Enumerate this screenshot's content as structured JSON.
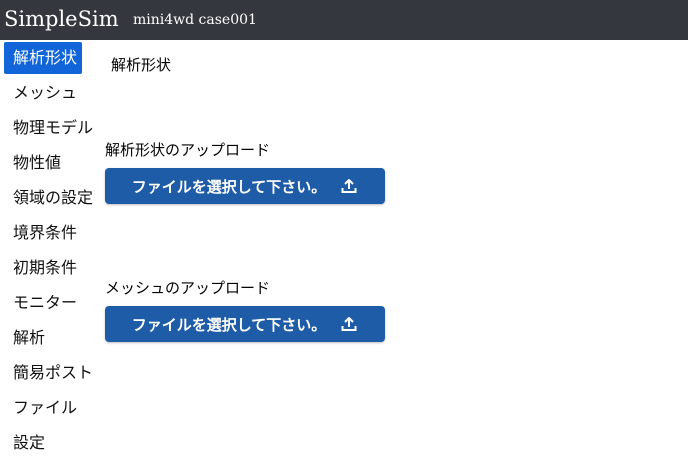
{
  "header": {
    "app_title": "SimpleSim",
    "project_name": "mini4wd case001"
  },
  "sidebar": {
    "items": [
      {
        "label": "解析形状",
        "active": true
      },
      {
        "label": "メッシュ",
        "active": false
      },
      {
        "label": "物理モデル",
        "active": false
      },
      {
        "label": "物性値",
        "active": false
      },
      {
        "label": "領域の設定",
        "active": false
      },
      {
        "label": "境界条件",
        "active": false
      },
      {
        "label": "初期条件",
        "active": false
      },
      {
        "label": "モニター",
        "active": false
      },
      {
        "label": "解析",
        "active": false
      },
      {
        "label": "簡易ポスト",
        "active": false
      },
      {
        "label": "ファイル",
        "active": false
      },
      {
        "label": "設定",
        "active": false
      }
    ]
  },
  "main": {
    "page_title": "解析形状",
    "sections": [
      {
        "label": "解析形状のアップロード",
        "button_label": "ファイルを選択して下さい。",
        "button_icon": "upload-icon"
      },
      {
        "label": "メッシュのアップロード",
        "button_label": "ファイルを選択して下さい。",
        "button_icon": "upload-icon"
      }
    ]
  },
  "colors": {
    "topbar_bg": "#34383e",
    "active_nav_bg": "#1165d8",
    "button_bg": "#1f5ca8"
  }
}
